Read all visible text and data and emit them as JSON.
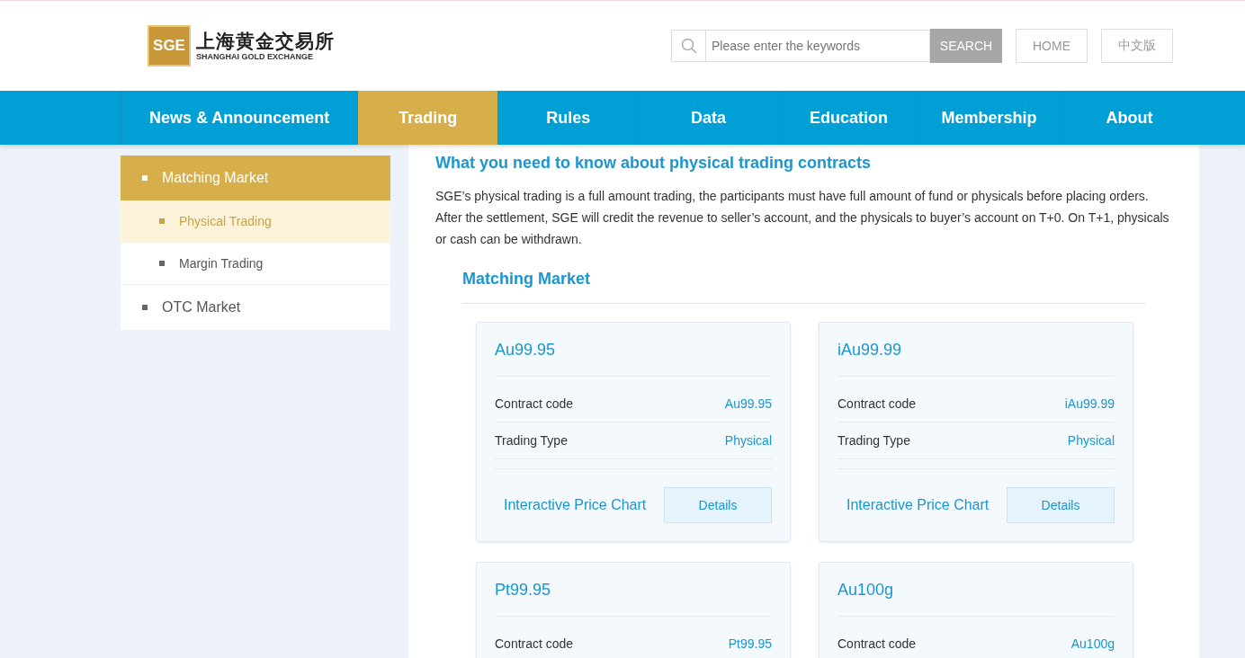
{
  "logo": {
    "chinese": "上海黄金交易所",
    "english": "SHANGHAI GOLD EXCHANGE",
    "mark": "SGE"
  },
  "search": {
    "placeholder": "Please enter the keywords",
    "button": "SEARCH"
  },
  "header_buttons": [
    "HOME",
    "中文版"
  ],
  "nav": [
    {
      "label": "News & Announcement",
      "selected": false
    },
    {
      "label": "Trading",
      "selected": true
    },
    {
      "label": "Rules",
      "selected": false
    },
    {
      "label": "Data",
      "selected": false
    },
    {
      "label": "Education",
      "selected": false
    },
    {
      "label": "Membership",
      "selected": false
    },
    {
      "label": "About",
      "selected": false
    }
  ],
  "sidebar": {
    "items": [
      {
        "label": "Matching Market",
        "selected": true,
        "children": [
          {
            "label": "Physical Trading",
            "selected": true
          },
          {
            "label": "Margin Trading",
            "selected": false
          }
        ]
      },
      {
        "label": "OTC Market",
        "selected": false
      }
    ]
  },
  "article": {
    "title": "What you need to know about physical trading contracts",
    "body": "SGE’s physical trading is a full amount trading, the participants must have full amount of fund or physicals before placing orders. After the settlement, SGE will credit the revenue to seller’s account, and the physicals to buyer’s account on T+0. On T+1, physicals or cash can be withdrawn.",
    "section": "Matching Market"
  },
  "contracts": [
    {
      "name": "Au99.95",
      "rows": [
        {
          "label": "Contract code",
          "value": "Au99.95"
        },
        {
          "label": "Trading Type",
          "value": "Physical"
        }
      ],
      "chart_link": "Interactive Price Chart",
      "button": "Details"
    },
    {
      "name": "iAu99.99",
      "rows": [
        {
          "label": "Contract code",
          "value": "iAu99.99"
        },
        {
          "label": "Trading Type",
          "value": "Physical"
        }
      ],
      "chart_link": "Interactive Price Chart",
      "button": "Details"
    },
    {
      "name": "Pt99.95",
      "rows": [
        {
          "label": "Contract code",
          "value": "Pt99.95"
        }
      ]
    },
    {
      "name": "Au100g",
      "rows": [
        {
          "label": "Contract code",
          "value": "Au100g"
        }
      ]
    }
  ]
}
